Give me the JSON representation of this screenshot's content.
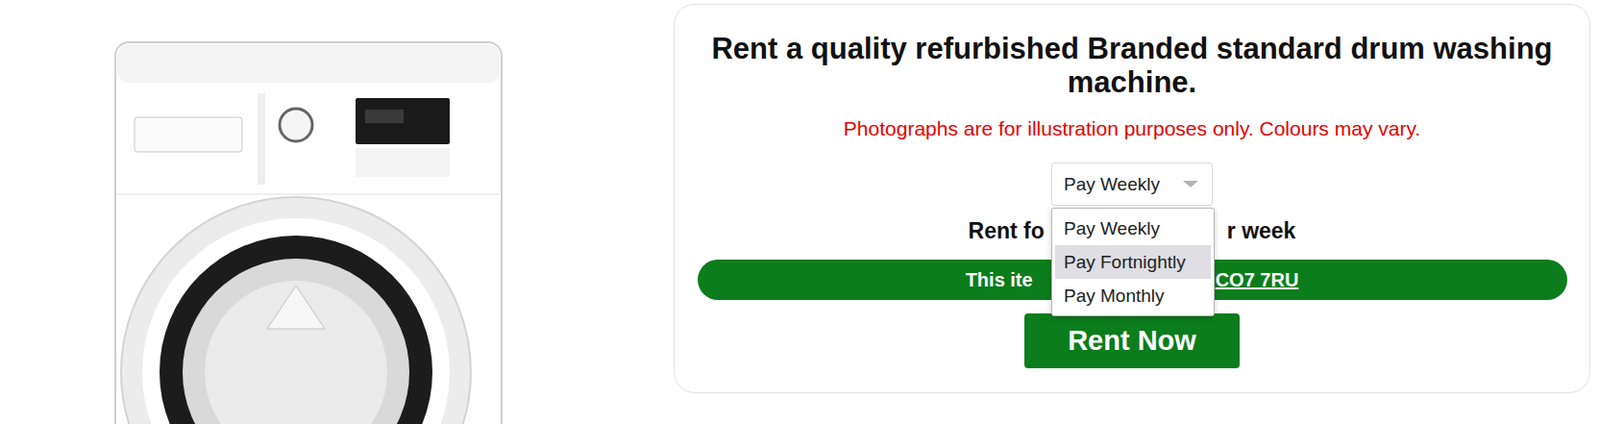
{
  "product": {
    "title": "Rent a quality refurbished Branded standard drum washing machine.",
    "notice": "Photographs are for illustration purposes only. Colours may vary."
  },
  "payment": {
    "expanded": true,
    "options": [
      {
        "label": "Pay Weekly",
        "selected": true,
        "highlighted": false
      },
      {
        "label": "Pay Fortnightly",
        "selected": false,
        "highlighted": true
      },
      {
        "label": "Pay Monthly",
        "selected": false,
        "highlighted": false
      }
    ]
  },
  "price": {
    "text_start": "Rent fo",
    "text_end": "r week"
  },
  "availability": {
    "text_start": "This ite",
    "postcode": "CO7 7RU"
  },
  "buttons": [
    "Rent Now"
  ]
}
